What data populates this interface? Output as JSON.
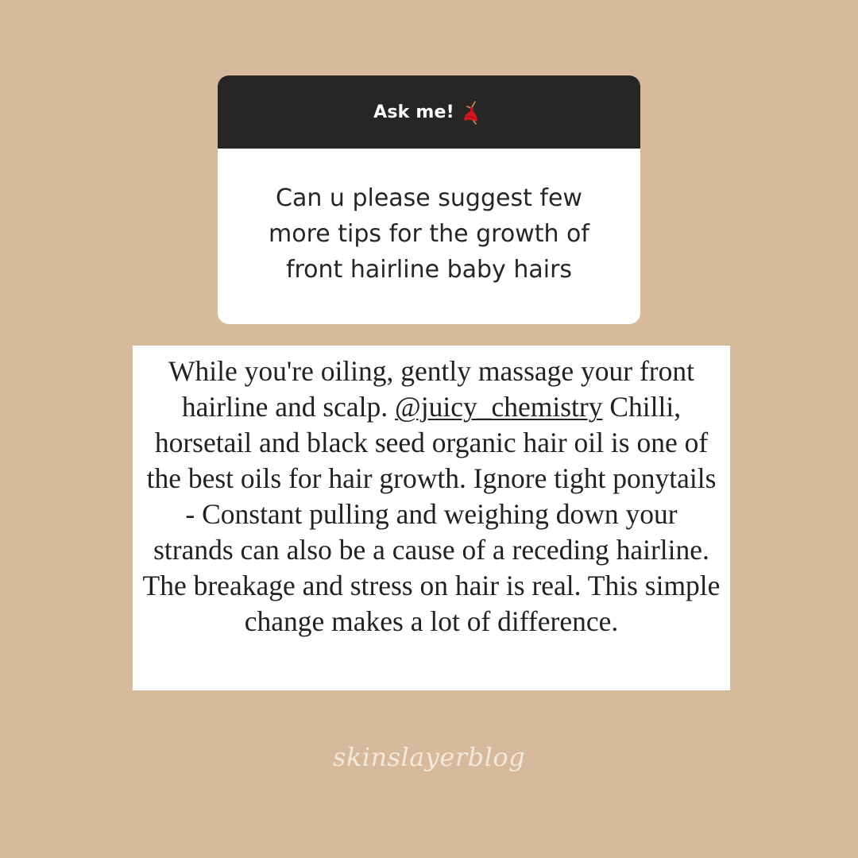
{
  "background_color": "#d7b99c",
  "ask_card": {
    "title": "Ask me!",
    "title_icon": "dancer-icon",
    "header_color": "#262626",
    "question": "Can u please suggest few more tips for the growth of front hairline baby hairs"
  },
  "answer": {
    "text_before_mention": "While you're oiling, gently massage your front hairline and scalp. ",
    "mention": "@juicy_chemistry",
    "text_after_mention": " Chilli, horsetail and black seed organic hair oil is one of the best oils for hair growth. Ignore tight ponytails - Constant pulling and weighing down your strands can also be a cause of a receding hairline. The breakage and stress on hair is real. This simple change makes a lot of difference."
  },
  "watermark": "skinslayerblog"
}
